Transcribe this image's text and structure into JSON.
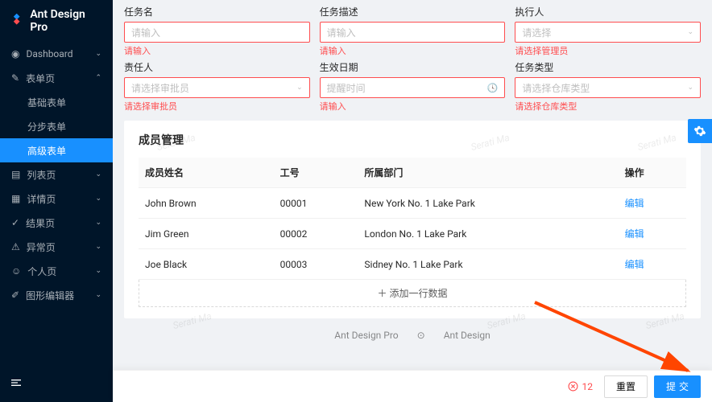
{
  "brand": "Ant Design Pro",
  "sidebar": {
    "items": [
      {
        "label": "Dashboard",
        "icon": "dashboard"
      },
      {
        "label": "表单页",
        "icon": "form",
        "open": true
      },
      {
        "label": "列表页",
        "icon": "table"
      },
      {
        "label": "详情页",
        "icon": "profile"
      },
      {
        "label": "结果页",
        "icon": "check-circle"
      },
      {
        "label": "异常页",
        "icon": "warning"
      },
      {
        "label": "个人页",
        "icon": "user"
      },
      {
        "label": "图形编辑器",
        "icon": "highlight"
      }
    ],
    "sub": [
      {
        "label": "基础表单"
      },
      {
        "label": "分步表单"
      },
      {
        "label": "高级表单",
        "active": true
      }
    ]
  },
  "form": {
    "row1": [
      {
        "label": "任务名",
        "placeholder": "请输入",
        "error": "请输入"
      },
      {
        "label": "任务描述",
        "placeholder": "请输入",
        "error": "请输入"
      },
      {
        "label": "执行人",
        "placeholder": "请选择",
        "error": "请选择管理员",
        "select": true
      }
    ],
    "row2": [
      {
        "label": "责任人",
        "placeholder": "请选择审批员",
        "error": "请选择审批员",
        "select": true
      },
      {
        "label": "生效日期",
        "placeholder": "提醒时间",
        "error": "请输入",
        "clock": true
      },
      {
        "label": "任务类型",
        "placeholder": "请选择仓库类型",
        "error": "请选择仓库类型",
        "select": true
      }
    ]
  },
  "members": {
    "title": "成员管理",
    "columns": [
      "成员姓名",
      "工号",
      "所属部门",
      "操作"
    ],
    "rows": [
      {
        "name": "John Brown",
        "id": "00001",
        "dept": "New York No. 1 Lake Park",
        "action": "编辑"
      },
      {
        "name": "Jim Green",
        "id": "00002",
        "dept": "London No. 1 Lake Park",
        "action": "编辑"
      },
      {
        "name": "Joe Black",
        "id": "00003",
        "dept": "Sidney No. 1 Lake Park",
        "action": "编辑"
      }
    ],
    "add": "添加一行数据"
  },
  "footer": {
    "a": "Ant Design Pro",
    "b": "Ant Design"
  },
  "bottom": {
    "errorCount": "12",
    "reset": "重置",
    "submit": "提交"
  },
  "watermark": "Serati Ma"
}
